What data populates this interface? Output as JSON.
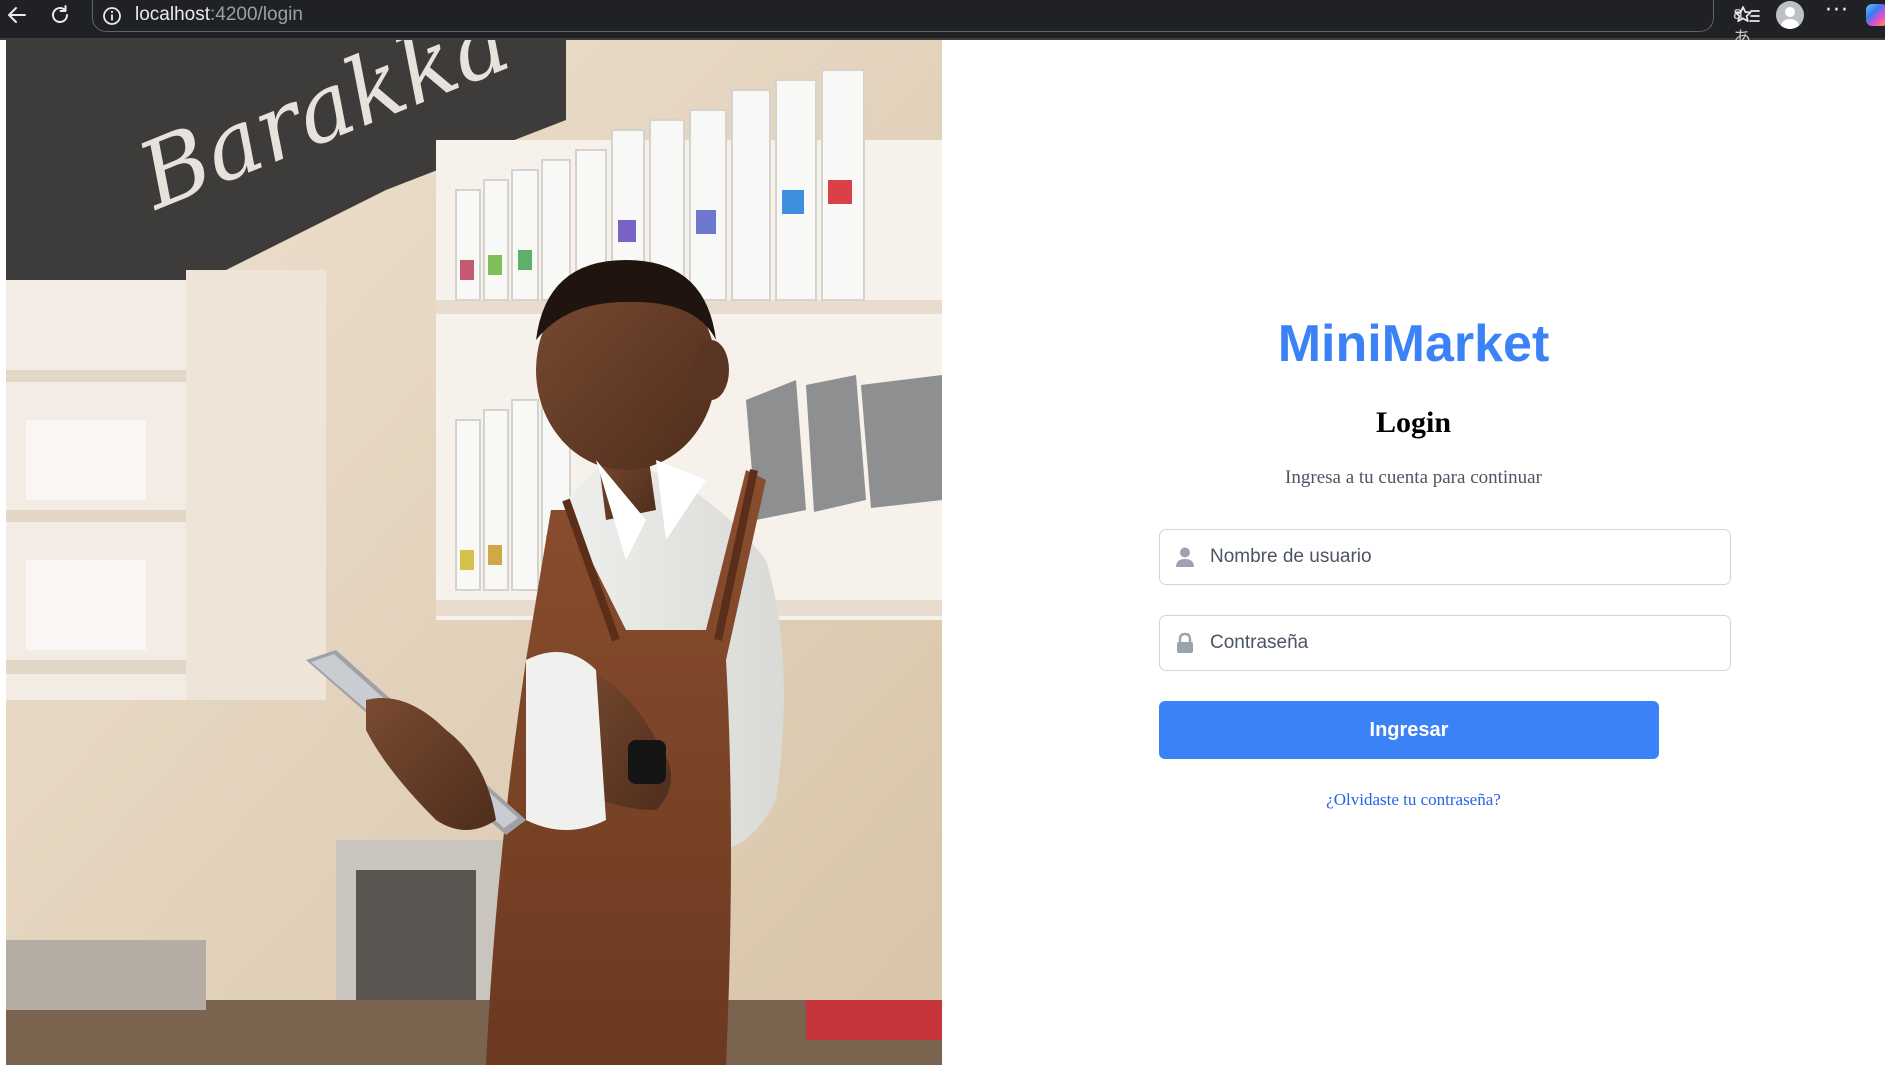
{
  "browser": {
    "url_host": "localhost",
    "url_path": ":4200/login",
    "read_aloud_label": "aあ"
  },
  "hero": {
    "image_subject": "barista-with-tablet-photo",
    "wall_lettering": "Barakka"
  },
  "login": {
    "brand": "MiniMarket",
    "heading": "Login",
    "subtitle": "Ingresa a tu cuenta para continuar",
    "username_placeholder": "Nombre de usuario",
    "password_placeholder": "Contraseña",
    "submit_label": "Ingresar",
    "forgot_label": "¿Olvidaste tu contraseña?"
  },
  "colors": {
    "accent": "#3b82f6",
    "link": "#2563eb",
    "field_border": "#d1d5db",
    "icon": "#9ca3af",
    "chrome_bg": "#202124"
  }
}
